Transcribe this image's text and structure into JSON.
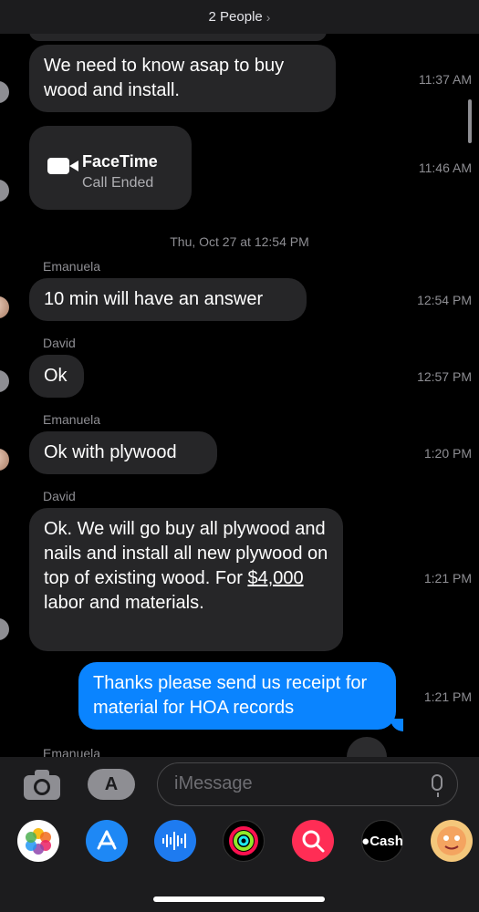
{
  "header": {
    "title": "2 People",
    "chevron": "›"
  },
  "messages": [
    {
      "text": "We need to know asap to buy wood and install.",
      "time": "11:37 AM"
    },
    {
      "facetime_title": "FaceTime",
      "facetime_sub": "Call Ended",
      "time": "11:46 AM",
      "icon": "video-camera-icon"
    },
    {
      "date_separator": "Thu, Oct 27 at 12:54 PM"
    },
    {
      "sender": "Emanuela",
      "text": "10 min will have an answer",
      "time": "12:54 PM"
    },
    {
      "sender": "David",
      "text": "Ok",
      "time": "12:57 PM"
    },
    {
      "sender": "Emanuela",
      "text": "Ok with plywood",
      "time": "1:20 PM"
    },
    {
      "sender": "David",
      "text_before": "Ok. We will go buy all plywood and nails and install all new plywood on top of existing wood. For ",
      "text_link": "$4,000",
      "text_after": " labor and materials.",
      "time": "1:21 PM"
    },
    {
      "outgoing": true,
      "text": "Thanks please send us receipt for material for HOA records",
      "time": "1:21 PM"
    },
    {
      "sender": "Emanuela"
    }
  ],
  "input": {
    "placeholder": "iMessage",
    "camera_icon": "camera-icon",
    "apps_icon": "app-store-icon",
    "mic_icon": "microphone-icon"
  },
  "dock": {
    "apps": [
      {
        "name": "photos-icon",
        "color": "#ffffff"
      },
      {
        "name": "app-store-icon",
        "color": "#1e88f5"
      },
      {
        "name": "audio-message-icon",
        "color": "#1e7bf0"
      },
      {
        "name": "activity-icon",
        "color": "#000000"
      },
      {
        "name": "search-images-icon",
        "color": "#ff2d55"
      },
      {
        "name": "apple-cash-icon",
        "color": "#000000",
        "label": "Cash"
      },
      {
        "name": "memoji-icon",
        "color": "#f4c77b"
      }
    ]
  },
  "colors": {
    "incoming_bubble": "#262628",
    "outgoing_bubble": "#0a84ff",
    "background": "#000000"
  }
}
